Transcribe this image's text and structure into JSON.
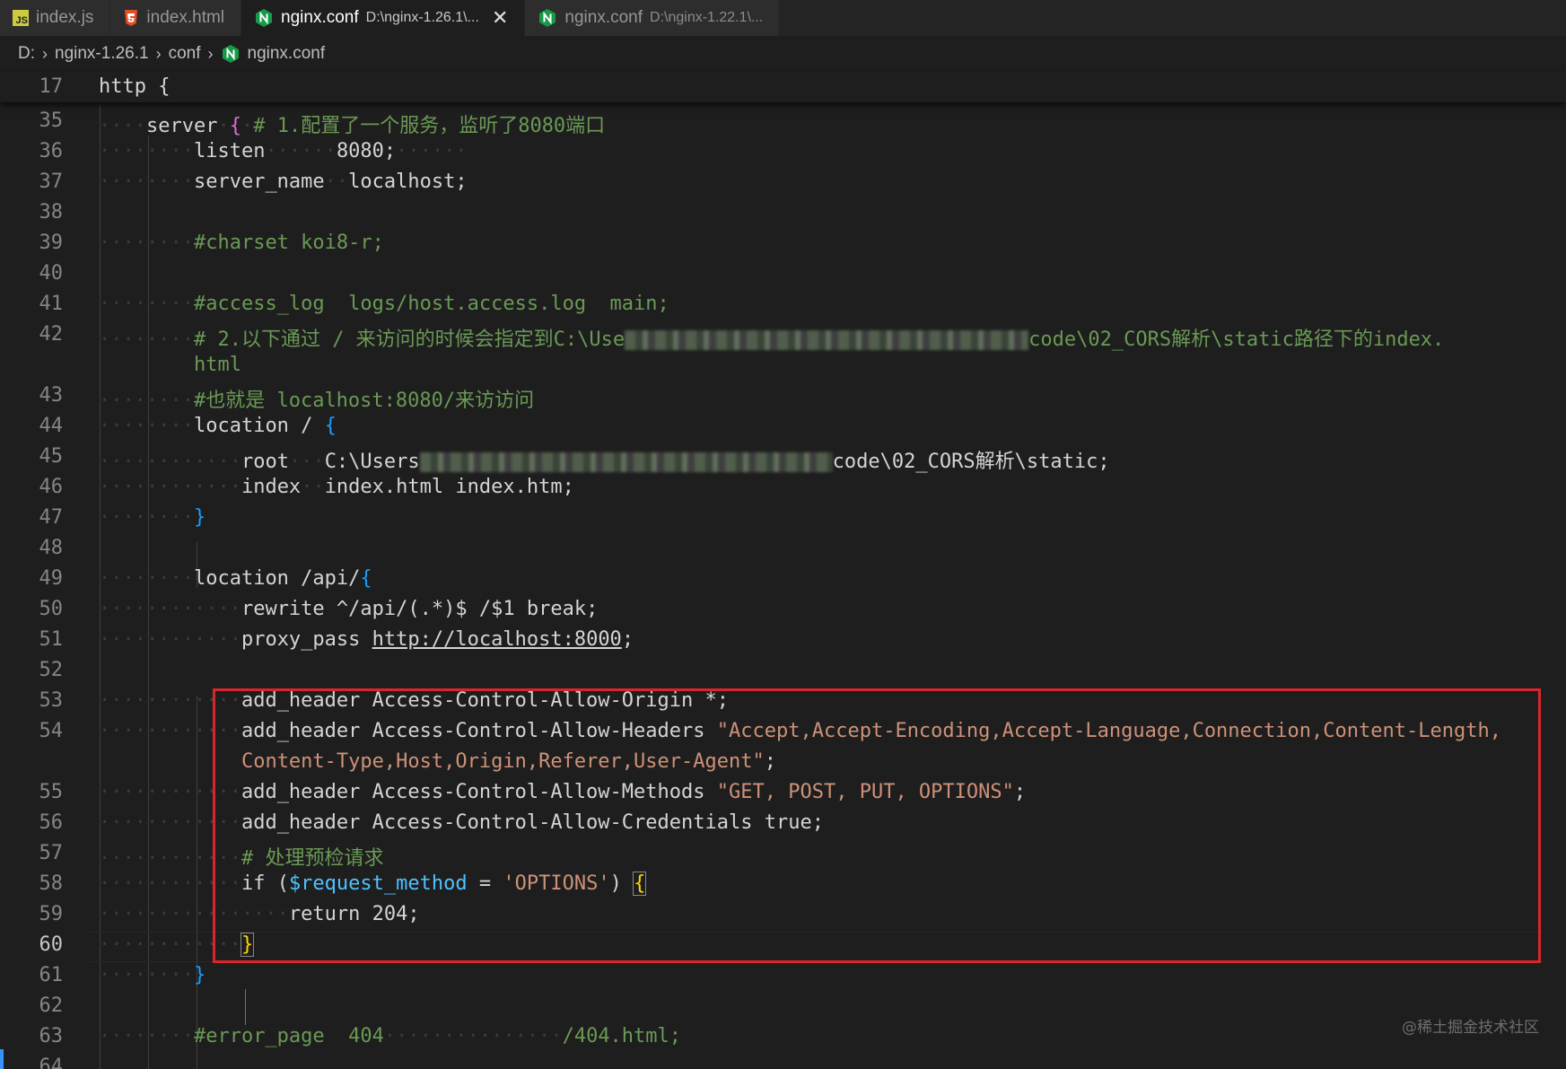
{
  "tabs": [
    {
      "name": "index.js",
      "path": "",
      "icon": "js-file-icon"
    },
    {
      "name": "index.html",
      "path": "",
      "icon": "html5-icon"
    },
    {
      "name": "nginx.conf",
      "path": "D:\\nginx-1.26.1\\...",
      "icon": "nginx-icon",
      "active": true,
      "close": "✕"
    },
    {
      "name": "nginx.conf",
      "path": "D:\\nginx-1.22.1\\...",
      "icon": "nginx-icon"
    }
  ],
  "breadcrumb": [
    "D:",
    "nginx-1.26.1",
    "conf",
    "nginx.conf"
  ],
  "sticky": {
    "line": "17",
    "code": "http {"
  },
  "lines": [
    {
      "n": "35"
    },
    {
      "n": "36"
    },
    {
      "n": "37"
    },
    {
      "n": "38"
    },
    {
      "n": "39"
    },
    {
      "n": "40"
    },
    {
      "n": "41"
    },
    {
      "n": "42"
    },
    {
      "n": ""
    },
    {
      "n": "43"
    },
    {
      "n": "44"
    },
    {
      "n": "45"
    },
    {
      "n": "46"
    },
    {
      "n": "47"
    },
    {
      "n": "48"
    },
    {
      "n": "49"
    },
    {
      "n": "50"
    },
    {
      "n": "51"
    },
    {
      "n": "52"
    },
    {
      "n": "53"
    },
    {
      "n": "54"
    },
    {
      "n": ""
    },
    {
      "n": "55"
    },
    {
      "n": "56"
    },
    {
      "n": "57"
    },
    {
      "n": "58"
    },
    {
      "n": "59"
    },
    {
      "n": "60"
    },
    {
      "n": "61"
    },
    {
      "n": "62"
    },
    {
      "n": "63"
    },
    {
      "n": "64"
    }
  ],
  "code": {
    "l35_kw": "server",
    "l35_cm": "# 1.配置了一个服务，监听了8080端口",
    "l36_kw": "listen",
    "l36_val": "8080",
    "l37_kw": "server_name",
    "l37_val": "localhost",
    "l39_cm": "#charset koi8-r;",
    "l41_cm": "#access_log  logs/host.access.log  main;",
    "l42_cm_a": "# 2.以下通过 / 来访问的时候会指定到C:\\Use",
    "l42_cm_b": "code\\02_CORS解析\\static路径下的index.",
    "l42b_cm": "html",
    "l43_cm": "#也就是 localhost:8080/来访访问",
    "l44_kw": "location / ",
    "l45_kw": "root",
    "l45_val_a": "C:\\Users",
    "l45_val_b": "code\\02_CORS解析\\static",
    "l46_kw": "index",
    "l46_val": "index.html index.htm",
    "l49_kw": "location /api/",
    "l50_kw": "rewrite ^/api/(.*)$ /$1 break",
    "l51_kw": "proxy_pass ",
    "l51_link": "http://localhost:8000",
    "l53_kw": "add_header Access-Control-Allow-Origin ",
    "l53_val": "*",
    "l54_kw": "add_header Access-Control-Allow-Headers ",
    "l54_str": "\"Accept,Accept-Encoding,Accept-Language,Connection,Content-Length,",
    "l54b_str": "Content-Type,Host,Origin,Referer,User-Agent\"",
    "l55_kw": "add_header Access-Control-Allow-Methods ",
    "l55_str": "\"GET, POST, PUT, OPTIONS\"",
    "l56_kw": "add_header Access-Control-Allow-Credentials true",
    "l57_cm": "# 处理预检请求",
    "l58_kw": "if (",
    "l58_var": "$request_method",
    "l58_eq": " = ",
    "l58_str": "'OPTIONS'",
    "l58_close": ") ",
    "l59_kw": "return 204",
    "l63_cm_a": "#error_page  404",
    "l63_cm_b": "/404.html;"
  },
  "watermark": "@稀土掘金技术社区"
}
